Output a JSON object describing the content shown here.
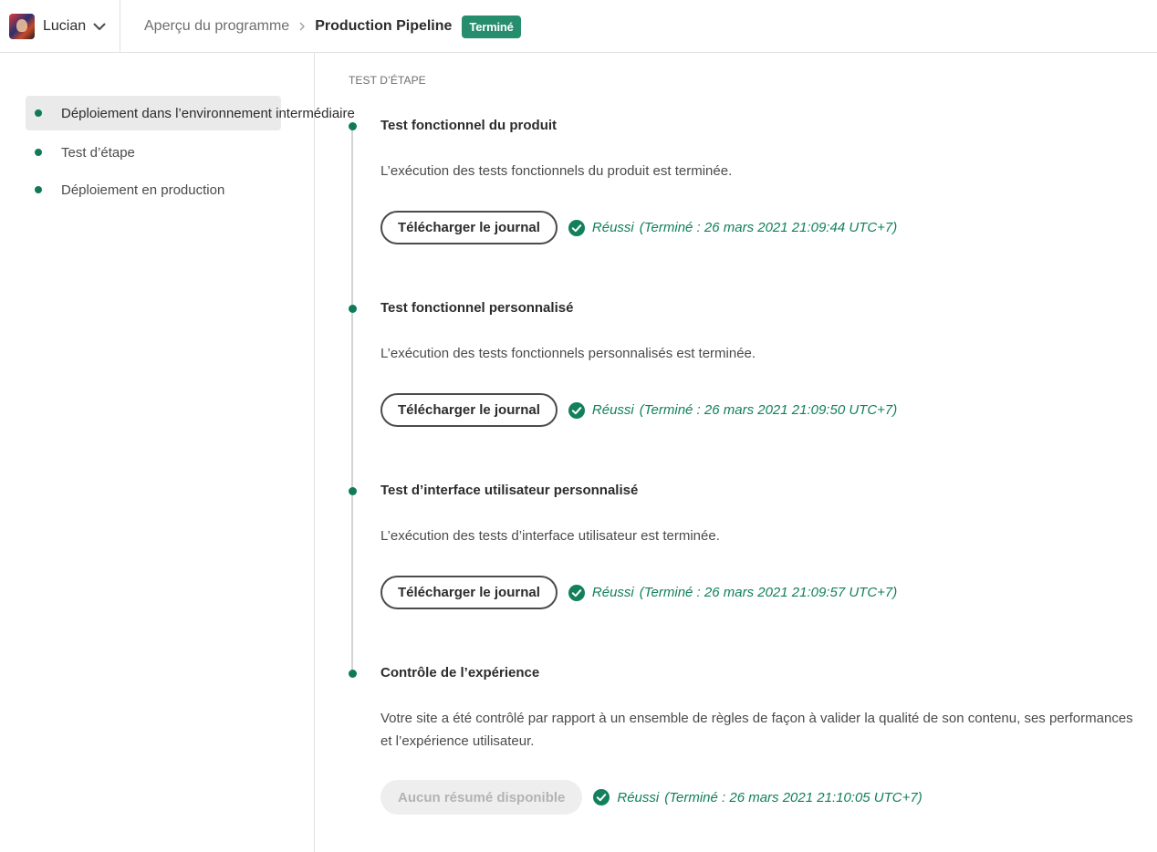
{
  "header": {
    "org_name": "Lucian",
    "breadcrumb_parent": "Aperçu du programme",
    "breadcrumb_current": "Production Pipeline",
    "status_badge": "Terminé",
    "badge_color": "#268e6c"
  },
  "sidebar": {
    "items": [
      {
        "label": "Déploiement dans l’environnement intermédiaire",
        "active": true
      },
      {
        "label": "Test d’étape",
        "active": false
      },
      {
        "label": "Déploiement en production",
        "active": false
      }
    ],
    "dot_color": "#0f7a5a"
  },
  "main": {
    "section_title": "TEST D’ÉTAPE",
    "steps": [
      {
        "title": "Test fonctionnel du produit",
        "description": "L’exécution des tests fonctionnels du produit est terminée.",
        "button_label": "Télécharger le journal",
        "status": "Réussi",
        "status_detail": "(Terminé : 26 mars 2021 21:09:44 UTC+7)"
      },
      {
        "title": "Test fonctionnel personnalisé",
        "description": "L’exécution des tests fonctionnels personnalisés est terminée.",
        "button_label": "Télécharger le journal",
        "status": "Réussi",
        "status_detail": "(Terminé : 26 mars 2021 21:09:50 UTC+7)"
      },
      {
        "title": "Test d’interface utilisateur personnalisé",
        "description": "L’exécution des tests d’interface utilisateur est terminée.",
        "button_label": "Télécharger le journal",
        "status": "Réussi",
        "status_detail": "(Terminé : 26 mars 2021 21:09:57 UTC+7)"
      },
      {
        "title": "Contrôle de l’expérience",
        "description": "Votre site a été contrôlé par rapport à un ensemble de règles de façon à valider la qualité de son contenu, ses performances et l’expérience utilisateur.",
        "button_label": "Aucun résumé disponible",
        "button_disabled": true,
        "status": "Réussi",
        "status_detail": "(Terminé : 26 mars 2021 21:10:05 UTC+7)"
      }
    ],
    "success_color": "#12805c"
  }
}
